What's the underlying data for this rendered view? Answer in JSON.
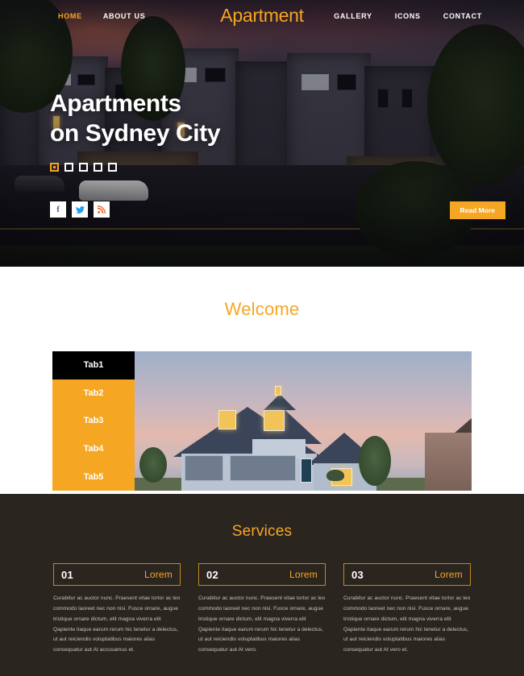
{
  "nav": {
    "brand": "Apartment",
    "left_items": [
      {
        "label": "HOME",
        "active": true
      },
      {
        "label": "ABOUT US",
        "active": false
      }
    ],
    "right_items": [
      {
        "label": "GALLERY",
        "active": false
      },
      {
        "label": "ICONS",
        "active": false
      },
      {
        "label": "CONTACT",
        "active": false
      }
    ]
  },
  "hero": {
    "title_line1": "Apartments",
    "title_line2": "on Sydney City",
    "slider_dots": 5,
    "active_dot": 1,
    "read_more_label": "Read More",
    "socials": [
      {
        "name": "facebook-icon",
        "glyph": "f",
        "color": "#3b5998"
      },
      {
        "name": "twitter-icon",
        "glyph": "ᵛ",
        "color": "#1da1f2"
      },
      {
        "name": "rss-icon",
        "glyph": "◤",
        "color": "#f26522"
      }
    ]
  },
  "welcome": {
    "title": "Welcome",
    "tabs": [
      {
        "label": "Tab1",
        "active": true
      },
      {
        "label": "Tab2",
        "active": false
      },
      {
        "label": "Tab3",
        "active": false
      },
      {
        "label": "Tab4",
        "active": false
      },
      {
        "label": "Tab5",
        "active": false
      }
    ]
  },
  "services": {
    "title": "Services",
    "cards": [
      {
        "number": "01",
        "label": "Lorem",
        "body": "Curabitur ac auctor nunc. Praesent vitae tortor ac leo commodo laoreet nec non nisi. Fusce ornare, augue tristique ornare dictum, elit magna viverra elit Qapiente itaque earum rerum hic tenetur a delectus, ut aut reiciendis voluptatibus maiores alias consequatur aut At accusamus et."
      },
      {
        "number": "02",
        "label": "Lorem",
        "body": "Curabitur ac auctor nunc. Praesent vitae tortor ac leo commodo laoreet nec non nisi. Fusce ornare, augue tristique ornare dictum, elit magna viverra elit Qapiente itaque earum rerum hic tenetur a delectus, ut aut reiciendis voluptatibus maiores alias consequatur aut At vero."
      },
      {
        "number": "03",
        "label": "Lorem",
        "body": "Curabitur ac auctor nunc. Praesent vitae tortor ac leo commodo laoreet nec non nisi. Fusce ornare, augue tristique ornare dictum, elit magna viverra elit Qapiente itaque earum rerum hic tenetur a delectus, ut aut reiciendis voluptatibus maiores alias consequatur aut At vero et."
      }
    ]
  },
  "colors": {
    "accent": "#f5a623",
    "dark_section": "#2b2520",
    "tab_active": "#000000",
    "card_border": "#c08a1e"
  }
}
